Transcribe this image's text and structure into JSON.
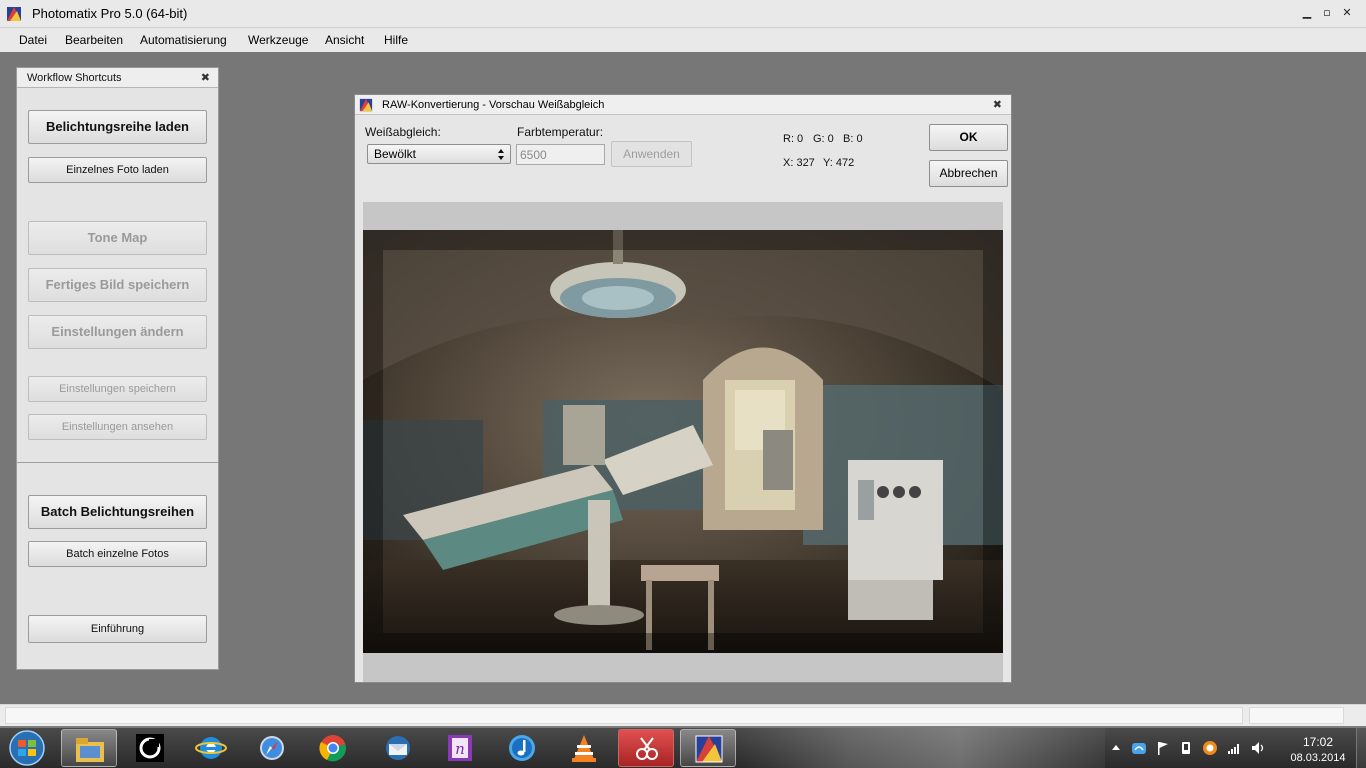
{
  "window": {
    "title": "Photomatix Pro 5.0 (64-bit)",
    "minimize": "▁",
    "maximize": "▫",
    "close": "✕"
  },
  "menu": [
    "Datei",
    "Bearbeiten",
    "Automatisierung",
    "Werkzeuge",
    "Ansicht",
    "Hilfe"
  ],
  "workflow": {
    "title": "Workflow Shortcuts",
    "close": "✖",
    "buttons": [
      {
        "label": "Belichtungsreihe laden",
        "enabled": true
      },
      {
        "label": "Einzelnes Foto laden",
        "enabled": true
      },
      {
        "label": "Tone Map",
        "enabled": false
      },
      {
        "label": "Fertiges Bild speichern",
        "enabled": false
      },
      {
        "label": "Einstellungen ändern",
        "enabled": false
      },
      {
        "label": "Einstellungen speichern",
        "enabled": false
      },
      {
        "label": "Einstellungen ansehen",
        "enabled": false
      },
      {
        "label": "Batch Belichtungsreihen",
        "enabled": true
      },
      {
        "label": "Batch einzelne Fotos",
        "enabled": true
      },
      {
        "label": "Einführung",
        "enabled": true
      }
    ]
  },
  "dialog": {
    "title": "RAW-Konvertierung - Vorschau Weißabgleich",
    "close": "✖",
    "white_balance_label": "Weißabgleich:",
    "white_balance_value": "Bewölkt",
    "temperature_label": "Farbtemperatur:",
    "temperature_value": "6500",
    "apply_label": "Anwenden",
    "rgb_readout": {
      "r": "R: 0",
      "g": "G: 0",
      "b": "B: 0"
    },
    "xy_readout": {
      "x": "X: 327",
      "y": "Y: 472"
    },
    "ok_label": "OK",
    "cancel_label": "Abbrechen"
  },
  "taskbar": {
    "apps": [
      "windows-explorer",
      "cinema4d",
      "internet-explorer",
      "safari",
      "chrome",
      "thunderbird",
      "onenote",
      "itunes",
      "vlc",
      "snipping-tool",
      "photomatix"
    ],
    "active_app": "photomatix",
    "clock_time": "17:02",
    "clock_date": "08.03.2014"
  },
  "colors": {
    "workspace": "#777777",
    "chrome": "#e9e9e9",
    "panel": "#e4e4e4",
    "disabled_text": "#9a9a9a"
  }
}
